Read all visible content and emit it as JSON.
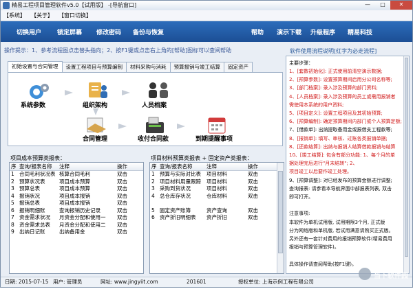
{
  "window": {
    "title": "精易工程项目管理软件v5.0【试用版】 -[导航窗口]",
    "buttons": {
      "minimize": "—",
      "maximize": "□",
      "close": "✕"
    }
  },
  "menu": [
    "【系统】",
    "【关于】",
    "【窗口切换】"
  ],
  "banner_nav": [
    "切换用户",
    "锁定屏幕",
    "修改密码",
    "备份与恢复",
    "帮助",
    "演示下载",
    "升级程序",
    "精易科技"
  ],
  "hint": "操作提示：1、参考流程图点击替头指向；2、按F1键或点击右上角的[帮助]图标可以查阅帮助",
  "tabs": [
    "初始设置与合同管理",
    "设置工程项目与预算编制",
    "材料采购与消耗",
    "预算报销与竣工结算",
    "固定资产"
  ],
  "flow": {
    "system": "系统参数",
    "org": "组织架构",
    "staff": "人员档案",
    "contract": "合同管理",
    "receivable": "收付合同款",
    "reminder": "到期提醒事项"
  },
  "left_list": {
    "title": "项目成本预算类报表：",
    "headers": [
      "序",
      "查询/报表名称",
      "注释",
      "操作"
    ],
    "rows": [
      [
        "1",
        "合同毛利状况表",
        "核算合同毛利",
        "双击"
      ],
      [
        "2",
        "预算状况表",
        "项目成本预算",
        "双击"
      ],
      [
        "3",
        "预算总表",
        "项目成本预算",
        "双击"
      ],
      [
        "4",
        "报销状况",
        "项目成本报销",
        "双击"
      ],
      [
        "5",
        "报销总表",
        "项目成本报销",
        "双击"
      ],
      [
        "6",
        "报销明细账",
        "查询报销历史记录",
        "双击"
      ],
      [
        "7",
        "资金需求状况",
        "月资金分配和使用一",
        "双击"
      ],
      [
        "8",
        "资金需求总表",
        "月资金分配和使用二",
        "双击"
      ],
      [
        "9",
        "出纳日记账",
        "出纳备用金",
        "双击"
      ]
    ]
  },
  "right_list": {
    "title": "项目材料预算类报表 + 固定资产类报表：",
    "headers": [
      "序",
      "查询/报表名称",
      "注释",
      "操作"
    ],
    "rows": [
      [
        "1",
        "预算与实际对比表",
        "项目材料",
        "双击"
      ],
      [
        "2",
        "项目材料用量跟踪",
        "项目材料",
        "双击"
      ],
      [
        "3",
        "采购到货状况",
        "项目材料",
        "双击"
      ],
      [
        "4",
        "总仓库存状况",
        "仓库材料",
        "双击"
      ],
      [
        "",
        "",
        "",
        ""
      ],
      [
        "5",
        "固定资产账簿",
        "资产查询",
        "双击"
      ],
      [
        "6",
        "资产折旧明细表",
        "资产折旧",
        "双击"
      ]
    ]
  },
  "right_panel": {
    "title": "软件使用流程说明[红字为必走流程]",
    "steps_title": "主要步骤：",
    "lines": [
      {
        "text": "1、[套数初始化]: 正式使用前清空演示数据;",
        "color": "red"
      },
      {
        "text": "2、[预算参数]: 设置预算期间启用分公司名称等;",
        "color": "red"
      },
      {
        "text": "3、[部门档案]: 录入涉及预算的部门资料;",
        "color": "red"
      },
      {
        "text": "4、[人员档案]: 录入涉及预算的员工或需用报销者",
        "color": "red"
      },
      {
        "text": "       需使用本系统的用户资料;",
        "color": "red"
      },
      {
        "text": "5、[项目定义]: 设置工程项目及其初始预算;",
        "color": "red"
      },
      {
        "text": "6、[预算编制]: 确定预算期间内部门或个人预算定额;",
        "color": "red"
      },
      {
        "text": "7、[借款单]: 出纳提取备用金或报借支工程款等;",
        "color": "blk"
      },
      {
        "text": "8、[报销单]: 填写、审核、过账各类报销单据;",
        "color": "red"
      },
      {
        "text": "8、[还款结算]: 出纳与报销人结算借款报销与结算",
        "color": "red"
      },
      {
        "text": "10、[竣工结算]: 包含有部分功能: 1、每个月的单",
        "color": "red"
      },
      {
        "text": "       据处理完后进行\"月末结转\"; 2、",
        "color": "red"
      },
      {
        "text": "       项目竣工以后要作竣工处理。",
        "color": "red"
      },
      {
        "text": "9、[预算调整]: 对已经发布的预算金额进行调整;",
        "color": "blk"
      },
      {
        "text": "查询报表: 请参看本导航界面中部报表列表, 双击",
        "color": "blk"
      },
      {
        "text": "       即可打开。",
        "color": "blk"
      },
      {
        "text": "",
        "color": "blk"
      },
      {
        "text": "注意事项:",
        "color": "blk"
      },
      {
        "text": "本软件为单机试用版, 试用期限3个月, 正式版",
        "color": "blk"
      },
      {
        "text": "分为网络版和单机版, 若试用满意请购买正式版。",
        "color": "blk"
      },
      {
        "text": "另外还有一套针对费用的报销预算软件(精易费用",
        "color": "blk"
      },
      {
        "text": "报销与预算管理软件)。",
        "color": "blk"
      },
      {
        "text": "",
        "color": "blk"
      },
      {
        "text": "具体操作请查阅帮助(按F1键)。",
        "color": "blk"
      }
    ]
  },
  "status": {
    "date": "日期: 2015-07-15",
    "user": "用户: 管理员",
    "website": "网址: www.jingyiit.com",
    "code": "201601",
    "license": "授权单位: 上海示例工程有限公司"
  },
  "watermark": "当下软件园",
  "colors": {
    "banner": "#2c6dbb",
    "red_text": "#d01818",
    "link_text": "#2a5a9a"
  }
}
